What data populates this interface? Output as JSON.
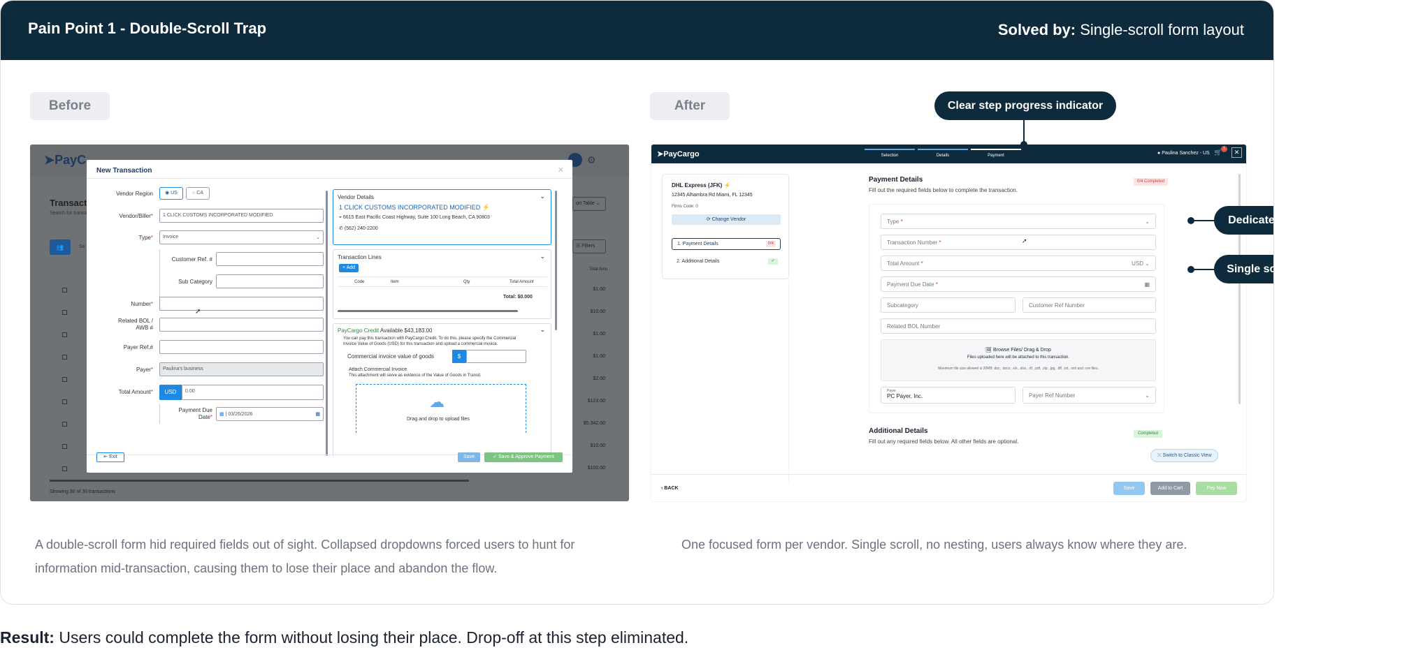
{
  "header": {
    "title": "Pain Point 1 - Double-Scroll Trap",
    "solved_label": "Solved by:",
    "solved_value": "Single-scroll form layout"
  },
  "before": {
    "label": "Before",
    "caption_line1": "A double-scroll form hid required fields out of sight. Collapsed dropdowns forced users to hunt for",
    "caption_line2": "information mid-transaction, causing them to lose their place and abandon the flow.",
    "screenshot": {
      "app_logo": "PayC",
      "page_title": "Transacti",
      "page_subtitle": "Search for transa",
      "search_stub": "Se",
      "sort_table": "ort Table",
      "filters": "Filters",
      "total_amt_header": "Total Amo",
      "amounts": [
        "$1.00",
        "$10.00",
        "$1.00",
        "$1.00",
        "$2.00",
        "$123.00",
        "$5,342.00",
        "$10.00",
        "$100.00"
      ],
      "showing": "Showing 30 of 30 transactions",
      "modal": {
        "title": "New Transaction",
        "vendor_region_label": "Vendor Region",
        "region_us": "US",
        "region_ca": "CA",
        "vendor_biller_label": "Vendor/Biller",
        "vendor_biller_value": "1 CLICK CUSTOMS INCORPORATED MODIFIED",
        "type_label": "Type",
        "type_value": "Invoice",
        "customer_ref_label": "Customer Ref. #",
        "sub_category_label": "Sub Category",
        "number_label": "Number",
        "related_bol_label1": "Related BOL /",
        "related_bol_label2": "AWB #",
        "payer_ref_label": "Payer Ref.#",
        "payer_label": "Payer",
        "payer_value": "Paulina's business",
        "total_amount_label": "Total Amount",
        "currency": "USD",
        "amount_value": "0.00",
        "payment_due_label1": "Payment Due",
        "payment_due_label2": "Date",
        "payment_due_value": "03/26/2026",
        "vendor_details_title": "Vendor Details",
        "vendor_name": "1 CLICK CUSTOMS INCORPORATED MODIFIED",
        "vendor_address": "6615 East Pacific Coast Highway, Suite 100 Long Beach, CA 90803",
        "vendor_phone": "(562) 240-2200",
        "transaction_lines_title": "Transaction Lines",
        "add_button": "Add",
        "col_code": "Code",
        "col_item": "Item",
        "col_qty": "Qty",
        "col_total": "Total Amount",
        "total_label": "Total:",
        "total_value": "$0.000",
        "credit_title": "PayCargo Credit",
        "credit_available": "Available $43,183.00",
        "credit_desc1": "You can pay this transaction with PayCargo Credit. To do this, please specify the Commercial",
        "credit_desc2": "Invoice Value of Goods (USD) for this transaction and upload a commercial invoice.",
        "commercial_value_label": "Commercial invoice value of goods",
        "dollar": "$",
        "attach_title": "Attach Commercial Invoice",
        "attach_desc": "This attachment will serve as evidence of the Value of Goods in Transit.",
        "upload_text": "Drag and drop to upload files",
        "exit_button": "Exit",
        "save_button": "Save",
        "save_approve_button": "Save & Approve Payment"
      }
    }
  },
  "after": {
    "label": "After",
    "caption": "One focused form per vendor. Single scroll, no nesting, users always know where they are.",
    "callouts": {
      "progress": "Clear step progress indicator",
      "dedicated": "Dedicated page. No form nesting",
      "single": "Single scroll · linear layout"
    },
    "screenshot": {
      "app_logo": "PayCargo",
      "steps": [
        "Selection",
        "Details",
        "Payment"
      ],
      "user": "Paulina Sanchez - US",
      "cart_count": "1",
      "vendor_name": "DHL Express (JFK)",
      "vendor_address": "12345 Alhambra Rd Miami, FL 12345",
      "firms_code": "Firms Code: 0",
      "change_vendor": "Change Vendor",
      "nav_payment": "1. Payment Details",
      "nav_payment_badge": "0/4",
      "nav_additional": "2. Additional Details",
      "back": "BACK",
      "section_title": "Payment Details",
      "section_desc": "Fill out the required fields below to complete the transaction.",
      "completed_badge": "0/4 Completed",
      "field_type": "Type",
      "field_txn_number": "Transaction Number",
      "field_total": "Total Amount",
      "field_currency": "USD",
      "field_due": "Payment Due Date",
      "field_subcategory": "Subcategory",
      "field_customer_ref": "Customer Ref Number",
      "field_bol": "Related BOL Number",
      "browse": "Browse Files/ Drag & Drop",
      "browse_note": "Files uploaded here will be attached to this transaction.",
      "browse_limit": "Maximum file size allowed is 20MB .doc, .docx, .xls, .xlsx, .rtf, .pdf, .zip, .jpg, .tiff, .txt, .xml and .csv files.",
      "payer_label": "Payer",
      "payer_value": "PC Payer, Inc.",
      "payer_ref": "Payer Ref Number",
      "additional_title": "Additional Details",
      "additional_desc": "Fill out any required fields below. All other fields are optional.",
      "additional_badge": "Completed",
      "classic_view": "Switch to Classic View",
      "save": "Save",
      "add_to_cart": "Add to Cart",
      "pay_now": "Pay Now"
    }
  },
  "result": {
    "label": "Result:",
    "text": "Users could complete the form without losing their place. Drop-off at this step eliminated."
  },
  "colors": {
    "header_bg": "#0e2a3d",
    "accent_blue": "#1e88e5",
    "success_green": "#5cb85c",
    "error_red": "#d9534f"
  }
}
